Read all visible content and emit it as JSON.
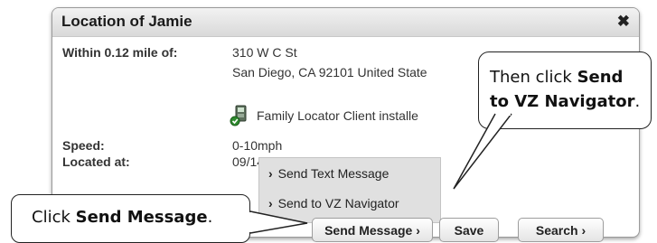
{
  "popup": {
    "title": "Location of Jamie",
    "close_glyph": "✖",
    "within_label": "Within 0.12 mile of:",
    "address_line1": "310 W C St",
    "address_line2": "San Diego, CA 92101 United State",
    "client_text": "Family Locator Client installe",
    "speed_label": "Speed:",
    "speed_value": "0-10mph",
    "located_label": "Located at:",
    "located_value": "09/14/11 1"
  },
  "menu": {
    "items": [
      {
        "label": "Send Text Message"
      },
      {
        "label": "Send to VZ Navigator"
      }
    ]
  },
  "buttons": {
    "send_message": "Send Message",
    "save": "Save",
    "search": "Search"
  },
  "callouts": {
    "left_prefix": "Click ",
    "left_bold": "Send Message",
    "left_suffix": ".",
    "right_line1_prefix": "Then click ",
    "right_line1_bold": "Send",
    "right_line2_bold": "to VZ Navigator",
    "right_line2_suffix": "."
  },
  "colors": {
    "header_bg": "#dddddd",
    "menu_bg": "#e0e0e0",
    "icon_green": "#2e8b2e"
  }
}
